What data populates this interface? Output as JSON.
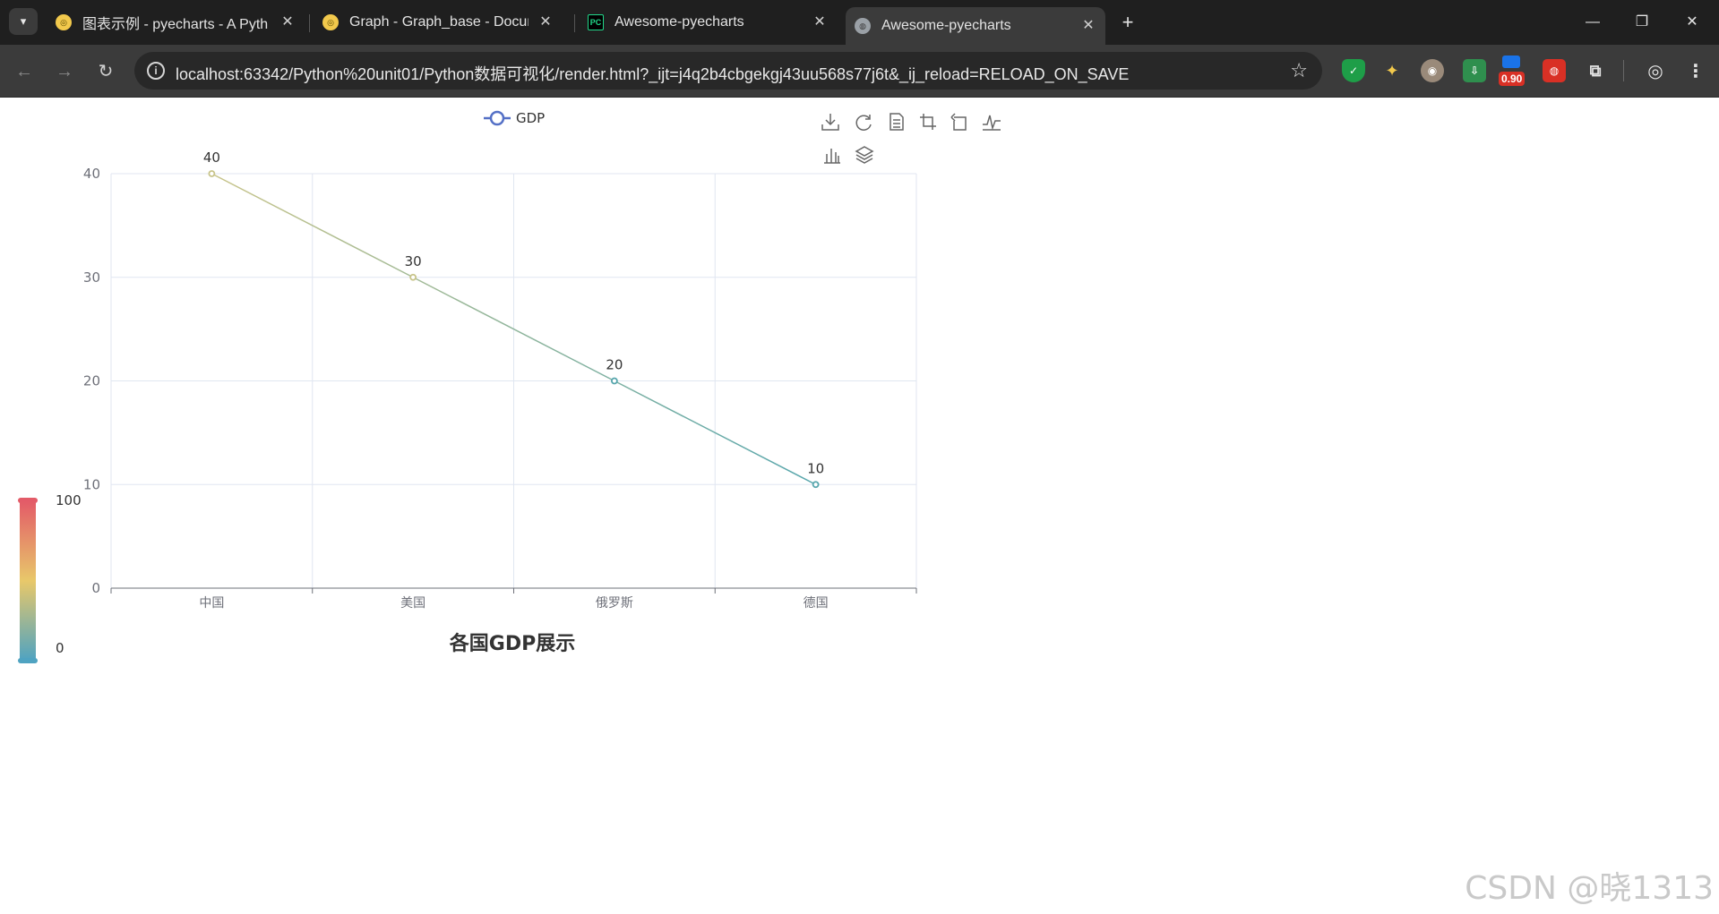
{
  "browser": {
    "tabs": [
      {
        "title": "图表示例 - pyecharts - A Pyth",
        "favicon": "pyecharts-icon",
        "active": false
      },
      {
        "title": "Graph - Graph_base - Docum",
        "favicon": "pyecharts-icon",
        "active": false
      },
      {
        "title": "Awesome-pyecharts",
        "favicon": "pycharm-icon",
        "active": false
      },
      {
        "title": "Awesome-pyecharts",
        "favicon": "globe-icon",
        "active": true
      }
    ],
    "url": "localhost:63342/Python%20unit01/Python数据可视化/render.html?_ijt=j4q2b4cbgekgj43uu568s77j6t&_ij_reload=RELOAD_ON_SAVE",
    "extension_badge": "0.90"
  },
  "chart_data": {
    "type": "line",
    "title": "各国GDP展示",
    "categories": [
      "中国",
      "美国",
      "俄罗斯",
      "德国"
    ],
    "series": [
      {
        "name": "GDP",
        "values": [
          40,
          30,
          20,
          10
        ]
      }
    ],
    "ylim": [
      0,
      40
    ],
    "yticks": [
      0,
      10,
      20,
      30,
      40
    ],
    "grid": true,
    "legend": "top",
    "visual_map": {
      "min": 0,
      "max": 100,
      "min_label": "0",
      "max_label": "100",
      "colors": [
        "#4fa3c1",
        "#e8c86a",
        "#e35b68"
      ]
    },
    "colors": {
      "line_start": "#c8c48a",
      "line_end": "#57a6ad",
      "legend": "#5470c6"
    }
  },
  "chart_toolbox": [
    "download-icon",
    "refresh-icon",
    "data-view-icon",
    "zoom-icon",
    "zoom-reset-icon",
    "line-chart-icon",
    "bar-chart-icon",
    "stack-icon"
  ],
  "watermark": "CSDN @晓1313"
}
